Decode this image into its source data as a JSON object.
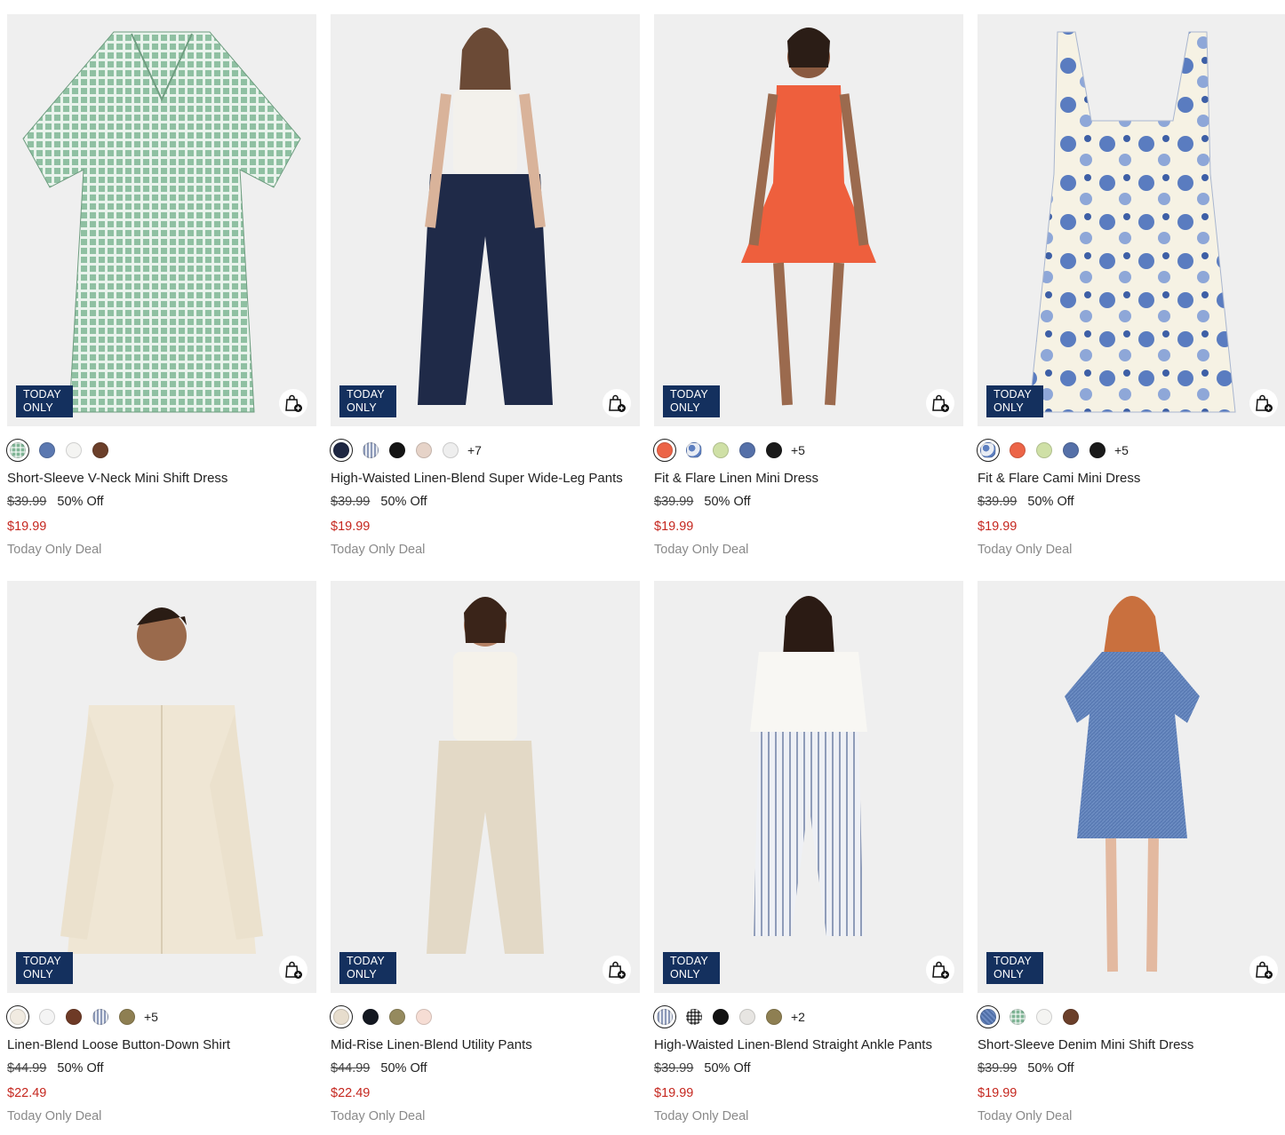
{
  "products": [
    {
      "name": "Short-Sleeve V-Neck Mini Shift Dress",
      "badge_line1": "TODAY",
      "badge_line2": "ONLY",
      "original_price": "$39.99",
      "discount": "50% Off",
      "sale_price": "$19.99",
      "deal_label": "Today Only Deal",
      "swatches": [
        "#7fb495",
        "#5b78b0",
        "#f4f4f2",
        "#6b3f2a"
      ],
      "swatch_patterns": [
        "plaid",
        "",
        "",
        ""
      ],
      "more": ""
    },
    {
      "name": "High-Waisted Linen-Blend Super Wide-Leg Pants",
      "badge_line1": "TODAY",
      "badge_line2": "ONLY",
      "original_price": "$39.99",
      "discount": "50% Off",
      "sale_price": "$19.99",
      "deal_label": "Today Only Deal",
      "swatches": [
        "#1e2742",
        "#d6d8e0",
        "#141414",
        "#e6d3c8",
        "#eeeeee"
      ],
      "swatch_patterns": [
        "",
        "stripe",
        "",
        "",
        ""
      ],
      "more": "+7"
    },
    {
      "name": "Fit & Flare Linen Mini Dress",
      "badge_line1": "TODAY",
      "badge_line2": "ONLY",
      "original_price": "$39.99",
      "discount": "50% Off",
      "sale_price": "$19.99",
      "deal_label": "Today Only Deal",
      "swatches": [
        "#ec6447",
        "#a9b8d8",
        "#cfe0a6",
        "#5570a8",
        "#1a1a1a"
      ],
      "swatch_patterns": [
        "",
        "floral",
        "",
        "",
        ""
      ],
      "more": "+5"
    },
    {
      "name": "Fit & Flare Cami Mini Dress",
      "badge_line1": "TODAY",
      "badge_line2": "ONLY",
      "original_price": "$39.99",
      "discount": "50% Off",
      "sale_price": "$19.99",
      "deal_label": "Today Only Deal",
      "swatches": [
        "#a9b8d8",
        "#ec6447",
        "#cfe0a6",
        "#5570a8",
        "#1a1a1a"
      ],
      "swatch_patterns": [
        "floral",
        "",
        "",
        "",
        ""
      ],
      "more": "+5"
    },
    {
      "name": "Linen-Blend Loose Button-Down Shirt",
      "badge_line1": "TODAY",
      "badge_line2": "ONLY",
      "original_price": "$44.99",
      "discount": "50% Off",
      "sale_price": "$22.49",
      "deal_label": "Today Only Deal",
      "swatches": [
        "#f1ebe1",
        "#f4f4f4",
        "#6e3a26",
        "#cfd3dd",
        "#8e7f52"
      ],
      "swatch_patterns": [
        "",
        "",
        "",
        "stripe",
        ""
      ],
      "more": "+5"
    },
    {
      "name": "Mid-Rise Linen-Blend Utility Pants",
      "badge_line1": "TODAY",
      "badge_line2": "ONLY",
      "original_price": "$44.99",
      "discount": "50% Off",
      "sale_price": "$22.49",
      "deal_label": "Today Only Deal",
      "swatches": [
        "#e7ddcd",
        "#141821",
        "#958a5e",
        "#f6ddd4"
      ],
      "swatch_patterns": [
        "",
        "",
        "",
        ""
      ],
      "more": ""
    },
    {
      "name": "High-Waisted Linen-Blend Straight Ankle Pants",
      "badge_line1": "TODAY",
      "badge_line2": "ONLY",
      "original_price": "$39.99",
      "discount": "50% Off",
      "sale_price": "$19.99",
      "deal_label": "Today Only Deal",
      "swatches": [
        "#c7cde0",
        "#777777",
        "#121212",
        "#e7e5e2",
        "#8e7f52"
      ],
      "swatch_patterns": [
        "stripe",
        "gingham",
        "",
        "",
        ""
      ],
      "more": "+2"
    },
    {
      "name": "Short-Sleeve Denim Mini Shift Dress",
      "badge_line1": "TODAY",
      "badge_line2": "ONLY",
      "original_price": "$39.99",
      "discount": "50% Off",
      "sale_price": "$19.99",
      "deal_label": "Today Only Deal",
      "swatches": [
        "#5b78b0",
        "#7fb495",
        "#f4f4f2",
        "#6b3f2a"
      ],
      "swatch_patterns": [
        "chambray",
        "plaid",
        "",
        ""
      ],
      "more": ""
    }
  ],
  "colors": {
    "badge_bg": "#14305e",
    "sale_red": "#c5271f",
    "deal_gray": "#8a8a8a",
    "image_bg": "#efefef"
  },
  "icons": {
    "add_to_bag": "shopping-bag-plus-icon"
  }
}
